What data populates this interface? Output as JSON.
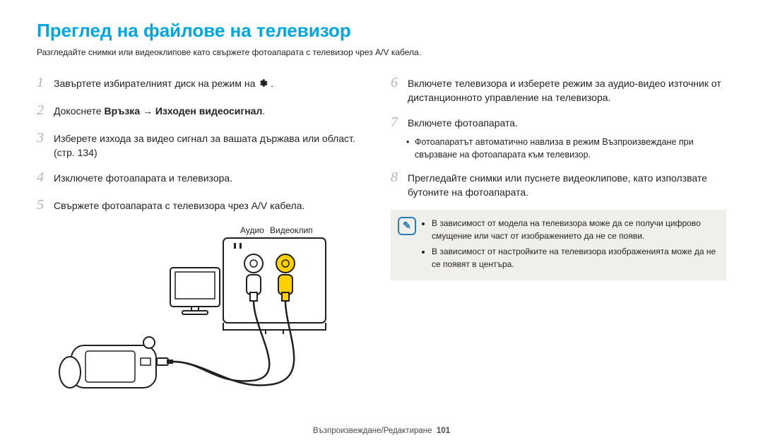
{
  "title": "Преглед на файлове на телевизор",
  "subtitle": "Разгледайте снимки или видеоклипове като свържете фотоапарата с телевизор чрез A/V кабела.",
  "left": {
    "s1_pre": "Завъртете избирателният диск на режим на ",
    "s1_post": ".",
    "s2_pre": "Докоснете ",
    "s2_bold": "Връзка → Изходен видеосигнал",
    "s2_post": ".",
    "s3": "Изберете изхода за видео сигнал за вашата държава или област. (стр. 134)",
    "s4": "Изключете фотоапарата и телевизора.",
    "s5": "Свържете фотоапарата с телевизора чрез A/V кабела."
  },
  "right": {
    "s6": "Включете телевизора и изберете режим за аудио-видео източник от дистанционното управление на телевизора.",
    "s7": "Включете фотоапарата.",
    "s7b1": "Фотоапаратът автоматично навлиза в режим Възпроизвеждане при свързване на фотоапарата към телевизор.",
    "s8": "Прегледайте снимки или пуснете видеоклипове, като използвате бутоните на фотоапарата."
  },
  "note": {
    "b1": "В зависимост от модела на телевизора може да се получи цифрово смущение или част от изображението да не се появи.",
    "b2": "В зависимост от настройките на телевизора изображенията може да не се появят в центъра."
  },
  "diagram": {
    "audio": "Аудио",
    "video": "Видеоклип"
  },
  "footer_text": "Възпроизвеждане/Редактиране",
  "footer_page": "101",
  "nums": {
    "n1": "1",
    "n2": "2",
    "n3": "3",
    "n4": "4",
    "n5": "5",
    "n6": "6",
    "n7": "7",
    "n8": "8"
  }
}
